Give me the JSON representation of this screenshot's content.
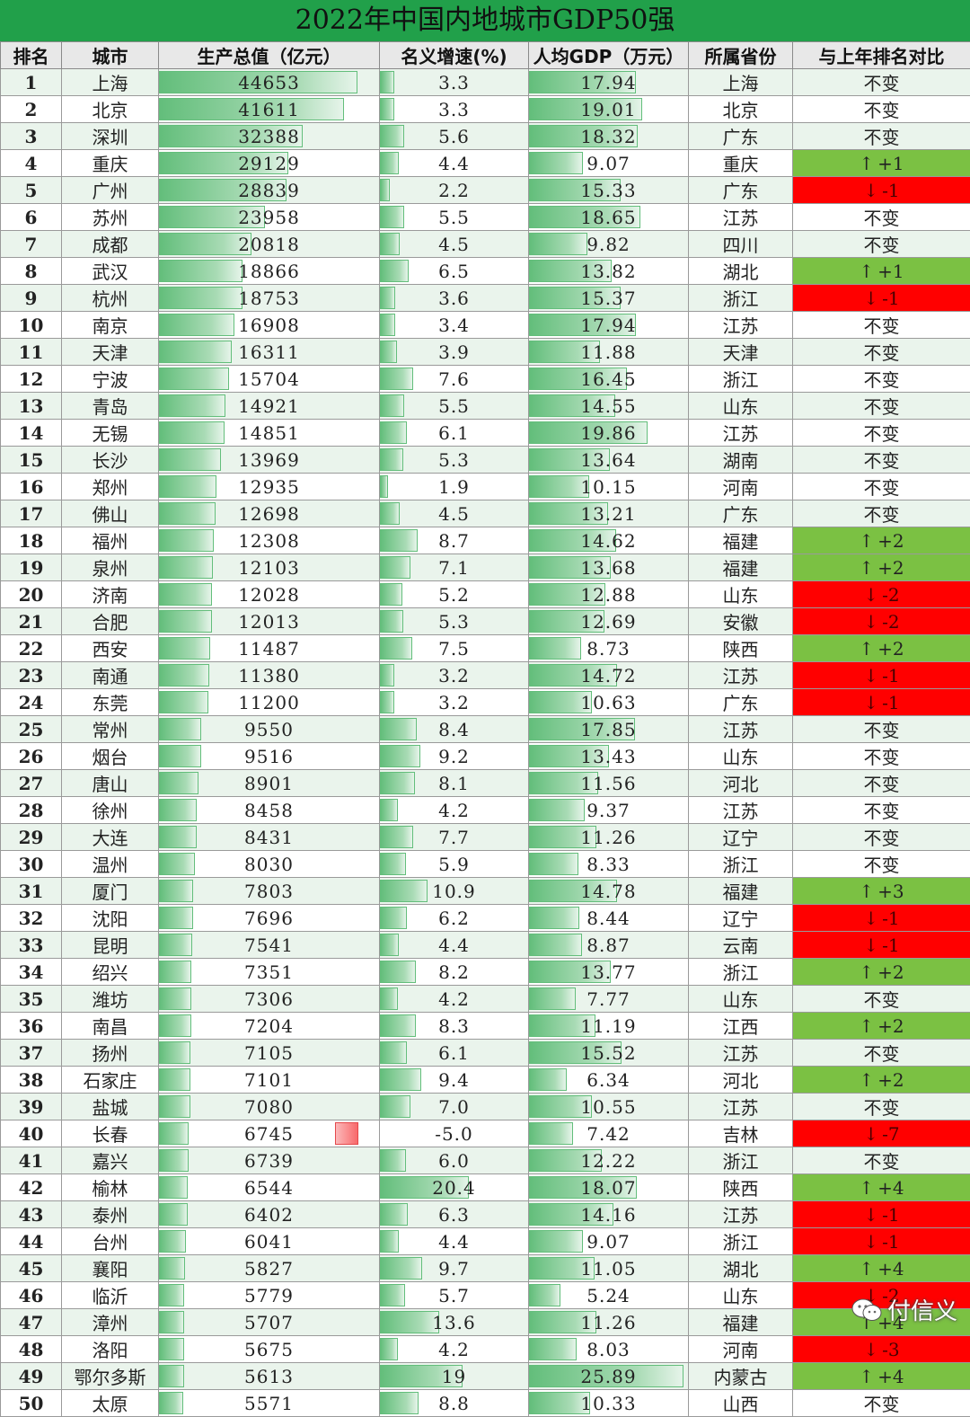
{
  "title": "2022年中国内地城市GDP50强",
  "headers": [
    "排名",
    "城市",
    "生产总值（亿元）",
    "名义增速(%)",
    "人均GDP（万元）",
    "所属省份",
    "与上年排名对比"
  ],
  "rows": [
    {
      "rank": "1",
      "city": "上海",
      "gdp": "44653",
      "growth": "3.3",
      "pc": "17.94",
      "prov": "上海",
      "cmp": "不变",
      "trend": "same"
    },
    {
      "rank": "2",
      "city": "北京",
      "gdp": "41611",
      "growth": "3.3",
      "pc": "19.01",
      "prov": "北京",
      "cmp": "不变",
      "trend": "same"
    },
    {
      "rank": "3",
      "city": "深圳",
      "gdp": "32388",
      "growth": "5.6",
      "pc": "18.32",
      "prov": "广东",
      "cmp": "不变",
      "trend": "same"
    },
    {
      "rank": "4",
      "city": "重庆",
      "gdp": "29129",
      "growth": "4.4",
      "pc": "9.07",
      "prov": "重庆",
      "cmp": "+1",
      "trend": "up"
    },
    {
      "rank": "5",
      "city": "广州",
      "gdp": "28839",
      "growth": "2.2",
      "pc": "15.33",
      "prov": "广东",
      "cmp": "-1",
      "trend": "down"
    },
    {
      "rank": "6",
      "city": "苏州",
      "gdp": "23958",
      "growth": "5.5",
      "pc": "18.65",
      "prov": "江苏",
      "cmp": "不变",
      "trend": "same"
    },
    {
      "rank": "7",
      "city": "成都",
      "gdp": "20818",
      "growth": "4.5",
      "pc": "9.82",
      "prov": "四川",
      "cmp": "不变",
      "trend": "same"
    },
    {
      "rank": "8",
      "city": "武汉",
      "gdp": "18866",
      "growth": "6.5",
      "pc": "13.82",
      "prov": "湖北",
      "cmp": "+1",
      "trend": "up"
    },
    {
      "rank": "9",
      "city": "杭州",
      "gdp": "18753",
      "growth": "3.6",
      "pc": "15.37",
      "prov": "浙江",
      "cmp": "-1",
      "trend": "down"
    },
    {
      "rank": "10",
      "city": "南京",
      "gdp": "16908",
      "growth": "3.4",
      "pc": "17.94",
      "prov": "江苏",
      "cmp": "不变",
      "trend": "same"
    },
    {
      "rank": "11",
      "city": "天津",
      "gdp": "16311",
      "growth": "3.9",
      "pc": "11.88",
      "prov": "天津",
      "cmp": "不变",
      "trend": "same"
    },
    {
      "rank": "12",
      "city": "宁波",
      "gdp": "15704",
      "growth": "7.6",
      "pc": "16.45",
      "prov": "浙江",
      "cmp": "不变",
      "trend": "same"
    },
    {
      "rank": "13",
      "city": "青岛",
      "gdp": "14921",
      "growth": "5.5",
      "pc": "14.55",
      "prov": "山东",
      "cmp": "不变",
      "trend": "same"
    },
    {
      "rank": "14",
      "city": "无锡",
      "gdp": "14851",
      "growth": "6.1",
      "pc": "19.86",
      "prov": "江苏",
      "cmp": "不变",
      "trend": "same"
    },
    {
      "rank": "15",
      "city": "长沙",
      "gdp": "13969",
      "growth": "5.3",
      "pc": "13.64",
      "prov": "湖南",
      "cmp": "不变",
      "trend": "same"
    },
    {
      "rank": "16",
      "city": "郑州",
      "gdp": "12935",
      "growth": "1.9",
      "pc": "10.15",
      "prov": "河南",
      "cmp": "不变",
      "trend": "same"
    },
    {
      "rank": "17",
      "city": "佛山",
      "gdp": "12698",
      "growth": "4.5",
      "pc": "13.21",
      "prov": "广东",
      "cmp": "不变",
      "trend": "same"
    },
    {
      "rank": "18",
      "city": "福州",
      "gdp": "12308",
      "growth": "8.7",
      "pc": "14.62",
      "prov": "福建",
      "cmp": "+2",
      "trend": "up"
    },
    {
      "rank": "19",
      "city": "泉州",
      "gdp": "12103",
      "growth": "7.1",
      "pc": "13.68",
      "prov": "福建",
      "cmp": "+2",
      "trend": "up"
    },
    {
      "rank": "20",
      "city": "济南",
      "gdp": "12028",
      "growth": "5.2",
      "pc": "12.88",
      "prov": "山东",
      "cmp": "-2",
      "trend": "down"
    },
    {
      "rank": "21",
      "city": "合肥",
      "gdp": "12013",
      "growth": "5.3",
      "pc": "12.69",
      "prov": "安徽",
      "cmp": "-2",
      "trend": "down"
    },
    {
      "rank": "22",
      "city": "西安",
      "gdp": "11487",
      "growth": "7.5",
      "pc": "8.73",
      "prov": "陕西",
      "cmp": "+2",
      "trend": "up"
    },
    {
      "rank": "23",
      "city": "南通",
      "gdp": "11380",
      "growth": "3.2",
      "pc": "14.72",
      "prov": "江苏",
      "cmp": "-1",
      "trend": "down"
    },
    {
      "rank": "24",
      "city": "东莞",
      "gdp": "11200",
      "growth": "3.2",
      "pc": "10.63",
      "prov": "广东",
      "cmp": "-1",
      "trend": "down"
    },
    {
      "rank": "25",
      "city": "常州",
      "gdp": "9550",
      "growth": "8.4",
      "pc": "17.85",
      "prov": "江苏",
      "cmp": "不变",
      "trend": "same"
    },
    {
      "rank": "26",
      "city": "烟台",
      "gdp": "9516",
      "growth": "9.2",
      "pc": "13.43",
      "prov": "山东",
      "cmp": "不变",
      "trend": "same"
    },
    {
      "rank": "27",
      "city": "唐山",
      "gdp": "8901",
      "growth": "8.1",
      "pc": "11.56",
      "prov": "河北",
      "cmp": "不变",
      "trend": "same"
    },
    {
      "rank": "28",
      "city": "徐州",
      "gdp": "8458",
      "growth": "4.2",
      "pc": "9.37",
      "prov": "江苏",
      "cmp": "不变",
      "trend": "same"
    },
    {
      "rank": "29",
      "city": "大连",
      "gdp": "8431",
      "growth": "7.7",
      "pc": "11.26",
      "prov": "辽宁",
      "cmp": "不变",
      "trend": "same"
    },
    {
      "rank": "30",
      "city": "温州",
      "gdp": "8030",
      "growth": "5.9",
      "pc": "8.33",
      "prov": "浙江",
      "cmp": "不变",
      "trend": "same"
    },
    {
      "rank": "31",
      "city": "厦门",
      "gdp": "7803",
      "growth": "10.9",
      "pc": "14.78",
      "prov": "福建",
      "cmp": "+3",
      "trend": "up"
    },
    {
      "rank": "32",
      "city": "沈阳",
      "gdp": "7696",
      "growth": "6.2",
      "pc": "8.44",
      "prov": "辽宁",
      "cmp": "-1",
      "trend": "down"
    },
    {
      "rank": "33",
      "city": "昆明",
      "gdp": "7541",
      "growth": "4.4",
      "pc": "8.87",
      "prov": "云南",
      "cmp": "-1",
      "trend": "down"
    },
    {
      "rank": "34",
      "city": "绍兴",
      "gdp": "7351",
      "growth": "8.2",
      "pc": "13.77",
      "prov": "浙江",
      "cmp": "+2",
      "trend": "up"
    },
    {
      "rank": "35",
      "city": "潍坊",
      "gdp": "7306",
      "growth": "4.2",
      "pc": "7.77",
      "prov": "山东",
      "cmp": "不变",
      "trend": "same"
    },
    {
      "rank": "36",
      "city": "南昌",
      "gdp": "7204",
      "growth": "8.3",
      "pc": "11.19",
      "prov": "江西",
      "cmp": "+2",
      "trend": "up"
    },
    {
      "rank": "37",
      "city": "扬州",
      "gdp": "7105",
      "growth": "6.1",
      "pc": "15.52",
      "prov": "江苏",
      "cmp": "不变",
      "trend": "same"
    },
    {
      "rank": "38",
      "city": "石家庄",
      "gdp": "7101",
      "growth": "9.4",
      "pc": "6.34",
      "prov": "河北",
      "cmp": "+2",
      "trend": "up"
    },
    {
      "rank": "39",
      "city": "盐城",
      "gdp": "7080",
      "growth": "7.0",
      "pc": "10.55",
      "prov": "江苏",
      "cmp": "不变",
      "trend": "same"
    },
    {
      "rank": "40",
      "city": "长春",
      "gdp": "6745",
      "growth": "-5.0",
      "pc": "7.42",
      "prov": "吉林",
      "cmp": "-7",
      "trend": "down"
    },
    {
      "rank": "41",
      "city": "嘉兴",
      "gdp": "6739",
      "growth": "6.0",
      "pc": "12.22",
      "prov": "浙江",
      "cmp": "不变",
      "trend": "same"
    },
    {
      "rank": "42",
      "city": "榆林",
      "gdp": "6544",
      "growth": "20.4",
      "pc": "18.07",
      "prov": "陕西",
      "cmp": "+4",
      "trend": "up"
    },
    {
      "rank": "43",
      "city": "泰州",
      "gdp": "6402",
      "growth": "6.3",
      "pc": "14.16",
      "prov": "江苏",
      "cmp": "-1",
      "trend": "down"
    },
    {
      "rank": "44",
      "city": "台州",
      "gdp": "6041",
      "growth": "4.4",
      "pc": "9.07",
      "prov": "浙江",
      "cmp": "-1",
      "trend": "down"
    },
    {
      "rank": "45",
      "city": "襄阳",
      "gdp": "5827",
      "growth": "9.7",
      "pc": "11.05",
      "prov": "湖北",
      "cmp": "+4",
      "trend": "up"
    },
    {
      "rank": "46",
      "city": "临沂",
      "gdp": "5779",
      "growth": "5.7",
      "pc": "5.24",
      "prov": "山东",
      "cmp": "-2",
      "trend": "down"
    },
    {
      "rank": "47",
      "city": "漳州",
      "gdp": "5707",
      "growth": "13.6",
      "pc": "11.26",
      "prov": "福建",
      "cmp": "+4",
      "trend": "up"
    },
    {
      "rank": "48",
      "city": "洛阳",
      "gdp": "5675",
      "growth": "4.2",
      "pc": "8.03",
      "prov": "河南",
      "cmp": "-3",
      "trend": "down"
    },
    {
      "rank": "49",
      "city": "鄂尔多斯",
      "gdp": "5613",
      "growth": "19",
      "pc": "25.89",
      "prov": "内蒙古",
      "cmp": "+4",
      "trend": "up"
    },
    {
      "rank": "50",
      "city": "太原",
      "gdp": "5571",
      "growth": "8.8",
      "pc": "10.33",
      "prov": "山西",
      "cmp": "不变",
      "trend": "same"
    }
  ],
  "arrows": {
    "up": "↑",
    "down": "↓"
  },
  "colors": {
    "title_bg": "#21a04a",
    "up": "#7bc143",
    "down": "#ff0000",
    "bar": "#63be7b"
  },
  "watermark": {
    "text": "付信义",
    "icon": "wechat-icon"
  }
}
